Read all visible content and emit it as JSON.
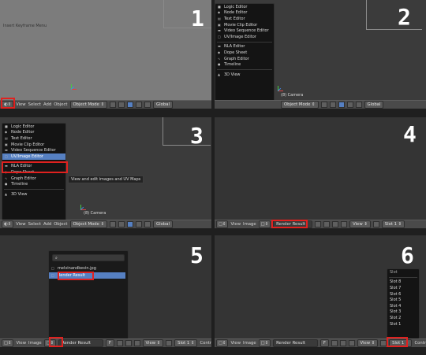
{
  "steps": [
    "1",
    "2",
    "3",
    "4",
    "5",
    "6"
  ],
  "header3d": {
    "view": "View",
    "select": "Select",
    "add": "Add",
    "object": "Object",
    "mode": "Object Mode",
    "pivot": "Global"
  },
  "overlay_text": "Insert Keyframe Menu",
  "camera_label": "(8) Camera",
  "editor_menu": {
    "items": [
      {
        "label": "Logic Editor",
        "icon": "logic-editor-icon"
      },
      {
        "label": "Node Editor",
        "icon": "node-editor-icon"
      },
      {
        "label": "Text Editor",
        "icon": "text-editor-icon"
      },
      {
        "label": "Movie Clip Editor",
        "icon": "movie-clip-icon"
      },
      {
        "label": "Video Sequence Editor",
        "icon": "sequencer-icon"
      },
      {
        "label": "UV/Image Editor",
        "icon": "image-editor-icon"
      },
      {
        "label": "NLA Editor",
        "icon": "nla-icon"
      },
      {
        "label": "Dope Sheet",
        "icon": "dope-sheet-icon"
      },
      {
        "label": "Graph Editor",
        "icon": "graph-editor-icon"
      },
      {
        "label": "Timeline",
        "icon": "timeline-icon"
      },
      {
        "label": "3D View",
        "icon": "view3d-icon"
      }
    ]
  },
  "tooltip": "View and edit images and UV Maps",
  "image_header": {
    "view": "View",
    "image": "Image",
    "image_name": "Render Result",
    "f_label": "F",
    "view_select": "View",
    "slot": "Slot 1",
    "contrast": "Contr"
  },
  "image_browser": {
    "search": "",
    "items": [
      "melvinandkevin.jpg",
      "Render Result"
    ]
  },
  "slot_menu": {
    "title": "Slot",
    "items": [
      "Slot 8",
      "Slot 7",
      "Slot 6",
      "Slot 5",
      "Slot 4",
      "Slot 3",
      "Slot 2",
      "Slot 1"
    ]
  },
  "colors": {
    "highlight": "#5680c2",
    "annotation": "#e0211f",
    "background": "#3b3b3b"
  }
}
